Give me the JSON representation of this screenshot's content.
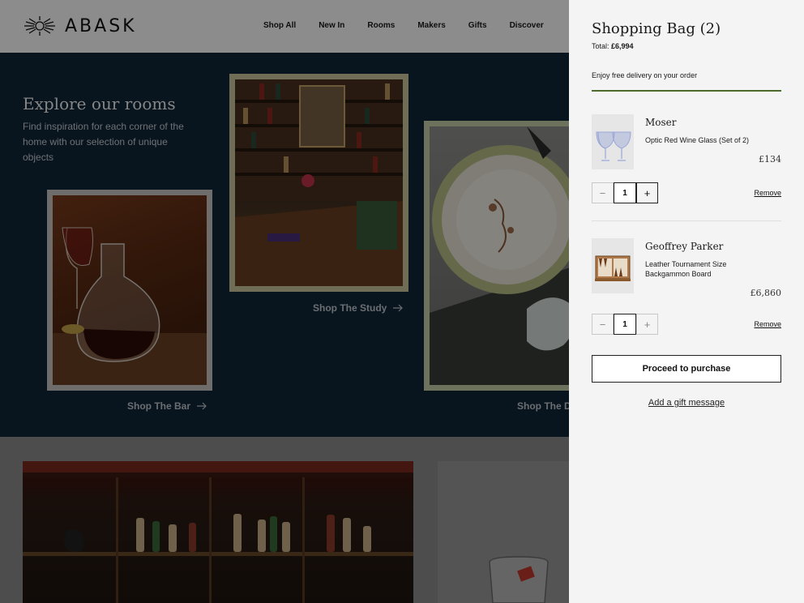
{
  "header": {
    "logo_text": "ABASK",
    "nav": [
      "Shop All",
      "New In",
      "Rooms",
      "Makers",
      "Gifts",
      "Discover"
    ]
  },
  "hero": {
    "title": "Explore our rooms",
    "description": "Find inspiration for each corner of the home with our selection of unique objects",
    "rooms": [
      {
        "link": "Shop The Bar"
      },
      {
        "link": "Shop The Study"
      },
      {
        "link": "Shop The Dining Room"
      }
    ]
  },
  "bag": {
    "title": "Shopping Bag (2)",
    "total_label": "Total:",
    "total_value": "£6,994",
    "delivery_note": "Enjoy free delivery on your order",
    "items": [
      {
        "maker": "Moser",
        "name": "Optic Red Wine Glass (Set of 2)",
        "price": "£134",
        "qty": "1",
        "remove": "Remove"
      },
      {
        "maker": "Geoffrey Parker",
        "name": "Leather Tournament Size Backgammon Board",
        "price": "£6,860",
        "qty": "1",
        "remove": "Remove"
      }
    ],
    "purchase_label": "Proceed to purchase",
    "gift_label": "Add a gift message",
    "minus": "−",
    "plus": "+"
  },
  "colors": {
    "hero_bg": "#102638",
    "delivery_accent": "#4d6b2e",
    "drawer_bg": "#f4f4f4"
  }
}
